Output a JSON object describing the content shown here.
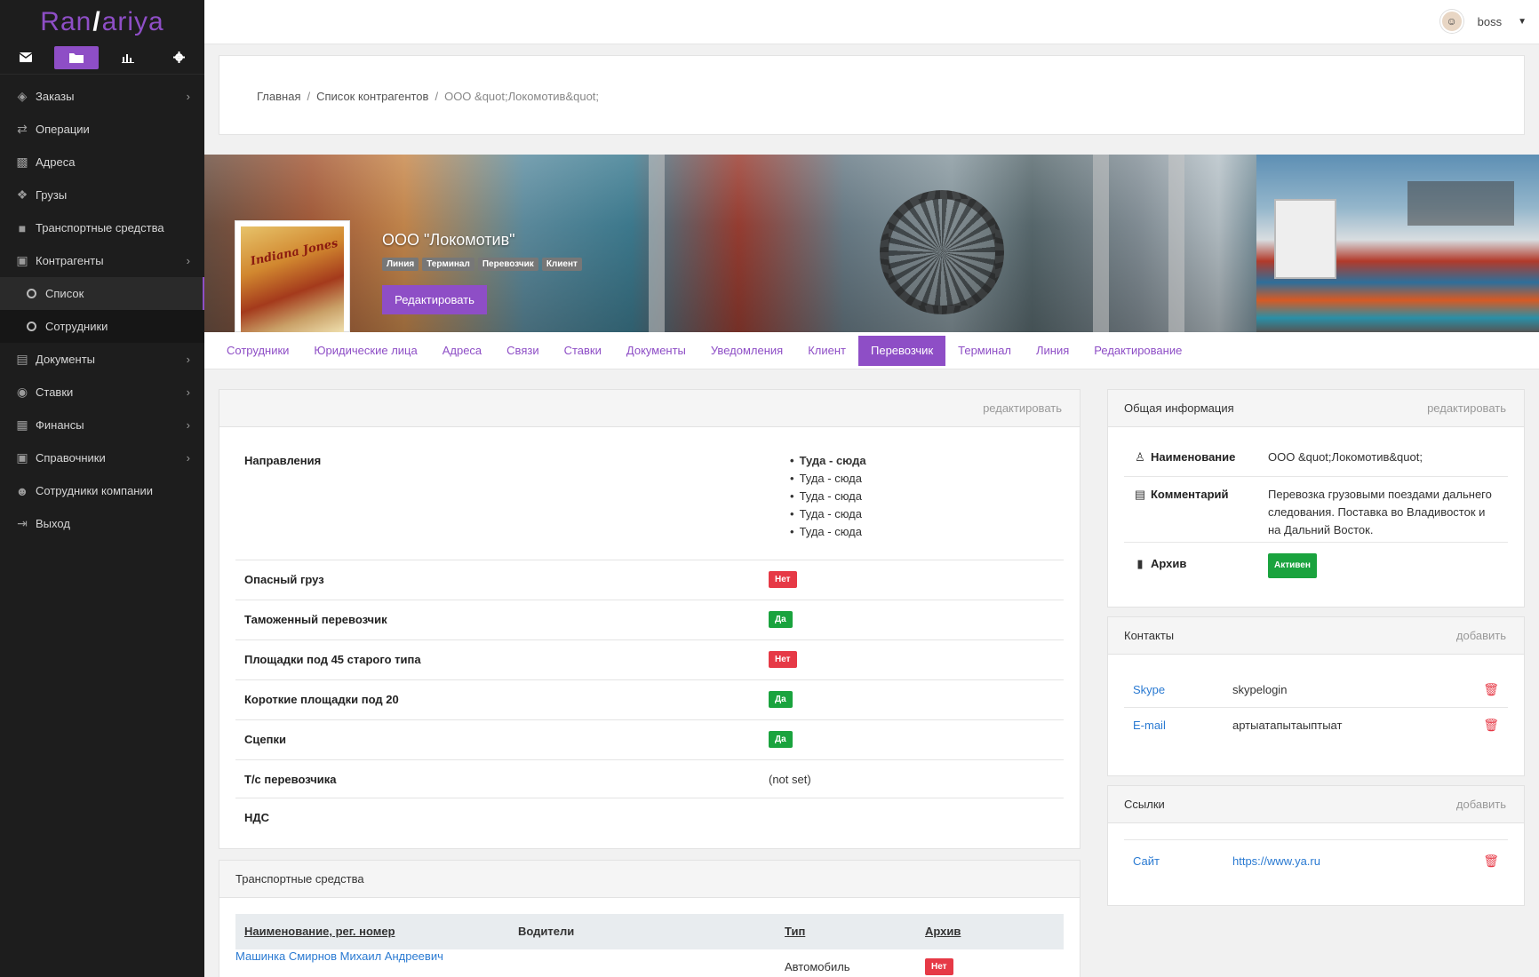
{
  "brand": {
    "logo_left": "Ran",
    "logo_mark": "/",
    "logo_right": "ariya"
  },
  "top_icons": [
    "envelope-icon",
    "folder-icon",
    "chart-icon",
    "gear-icon"
  ],
  "sidebar": {
    "items": [
      {
        "label": "Заказы",
        "icon": "layers-icon",
        "chevron": true
      },
      {
        "label": "Операции",
        "icon": "exchange-icon",
        "chevron": false
      },
      {
        "label": "Адреса",
        "icon": "map-icon",
        "chevron": false
      },
      {
        "label": "Грузы",
        "icon": "cubes-icon",
        "chevron": false
      },
      {
        "label": "Транспортные средства",
        "icon": "truck-icon",
        "chevron": false
      },
      {
        "label": "Контрагенты",
        "icon": "briefcase-icon",
        "chevron": true
      },
      {
        "label": "Список",
        "sub": true,
        "active": true
      },
      {
        "label": "Сотрудники",
        "sub": true
      },
      {
        "label": "Документы",
        "icon": "word-icon",
        "chevron": true
      },
      {
        "label": "Ставки",
        "icon": "eye-icon",
        "chevron": true
      },
      {
        "label": "Финансы",
        "icon": "money-icon",
        "chevron": true
      },
      {
        "label": "Справочники",
        "icon": "archive-icon",
        "chevron": true
      },
      {
        "label": "Сотрудники компании",
        "icon": "users-icon",
        "chevron": false
      },
      {
        "label": "Выход",
        "icon": "signout-icon",
        "chevron": false
      }
    ]
  },
  "user": {
    "name": "boss"
  },
  "breadcrumb": {
    "home": "Главная",
    "list": "Список контрагентов",
    "current": "ООО &quot;Локомотив&quot;"
  },
  "profile": {
    "company": "ООО \"Локомотив\"",
    "tags": [
      "Линия",
      "Терминал",
      "Перевозчик",
      "Клиент"
    ],
    "edit_label": "Редактировать",
    "poster_text": "Indiana Jones"
  },
  "tabs": [
    "Сотрудники",
    "Юридические лица",
    "Адреса",
    "Связи",
    "Ставки",
    "Документы",
    "Уведомления",
    "Клиент",
    "Перевозчик",
    "Терминал",
    "Линия",
    "Редактирование"
  ],
  "active_tab": "Перевозчик",
  "carrier": {
    "head_action": "редактировать",
    "directions_label": "Направления",
    "directions": [
      {
        "text": "Туда - сюда",
        "bold": true
      },
      {
        "text": "Туда - сюда",
        "bold": false
      },
      {
        "text": "Туда - сюда",
        "bold": false
      },
      {
        "text": "Туда - сюда",
        "bold": false
      },
      {
        "text": "Туда - сюда",
        "bold": false
      }
    ],
    "rows": [
      {
        "label": "Опасный груз",
        "badge": "Нет",
        "color": "red"
      },
      {
        "label": "Таможенный перевозчик",
        "badge": "Да",
        "color": "green"
      },
      {
        "label": "Площадки под 45 старого типа",
        "badge": "Нет",
        "color": "red"
      },
      {
        "label": "Короткие площадки под 20",
        "badge": "Да",
        "color": "green"
      },
      {
        "label": "Сцепки",
        "badge": "Да",
        "color": "green"
      }
    ],
    "ts_label": "Т/с перевозчика",
    "ts_value": "(not set)",
    "vat_label": "НДС"
  },
  "info": {
    "title": "Общая информация",
    "action": "редактировать",
    "name_label": "Наименование",
    "name_value": "ООО &quot;Локомотив&quot;",
    "comment_label": "Комментарий",
    "comment_value": "Перевозка грузовыми поездами дальнего следования. Поставка во Владивосток и на Дальний Восток.",
    "archive_label": "Архив",
    "archive_value": "Активен"
  },
  "contacts": {
    "title": "Контакты",
    "action": "добавить",
    "items": [
      {
        "type": "Skype",
        "value": "skypelogin"
      },
      {
        "type": "E-mail",
        "value": "артыатапытаыптыат"
      }
    ]
  },
  "links": {
    "title": "Ссылки",
    "action": "добавить",
    "items": [
      {
        "type": "Сайт",
        "value": "https://www.ya.ru"
      }
    ]
  },
  "vehicles": {
    "title": "Транспортные средства",
    "columns": [
      "Наименование, рег. номер",
      "Водители",
      "Тип",
      "Архив"
    ],
    "rows": [
      {
        "name": "Машинка",
        "drivers": "Смирнов Михаил Андреевич",
        "type": "Автомобиль",
        "archive": "Нет"
      }
    ]
  }
}
